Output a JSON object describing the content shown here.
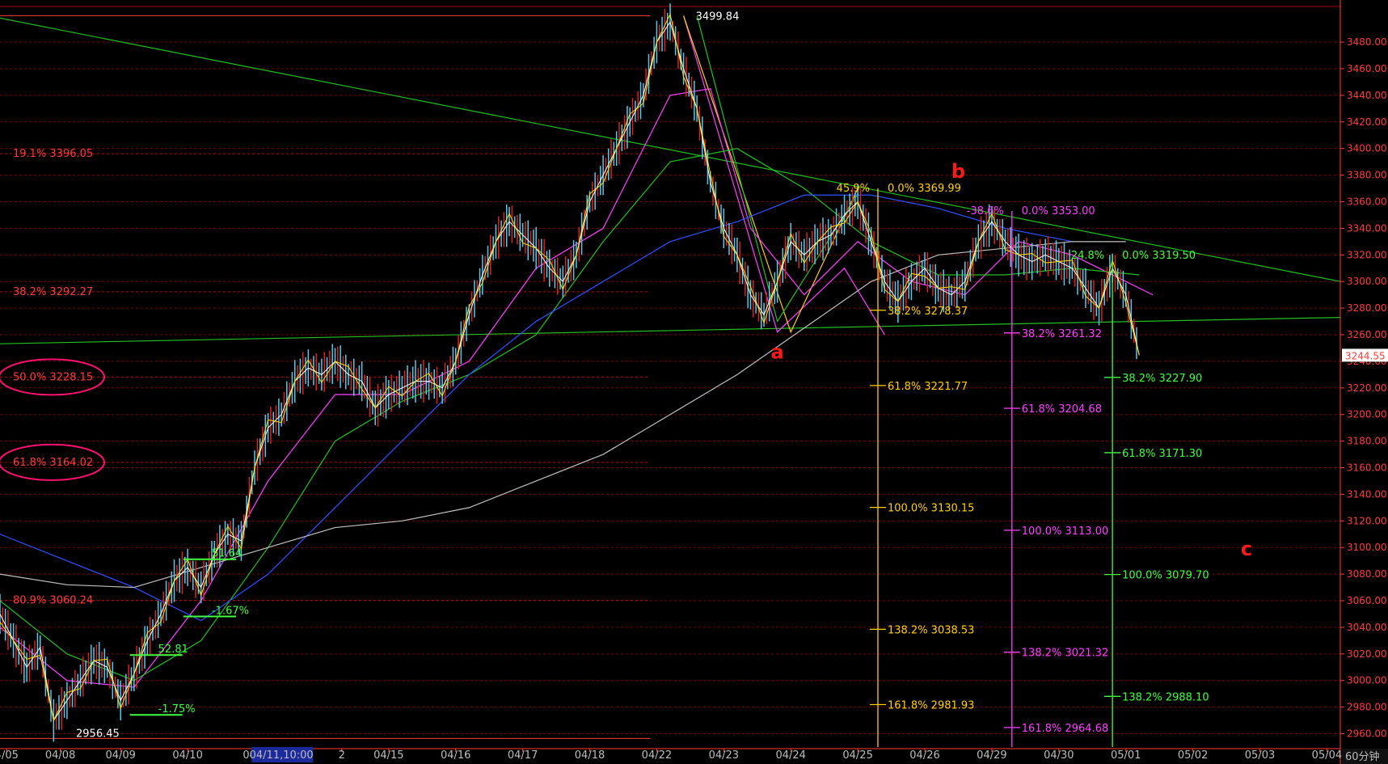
{
  "chart_data": {
    "type": "line",
    "timeframe_label": "60分钟",
    "ylim": [
      2950,
      3508
    ],
    "y_ticks": [
      2960,
      2980,
      3000,
      3020,
      3040,
      3060,
      3080,
      3100,
      3120,
      3140,
      3160,
      3180,
      3200,
      3220,
      3240,
      3260,
      3280,
      3300,
      3320,
      3340,
      3360,
      3380,
      3400,
      3420,
      3440,
      3460,
      3480
    ],
    "y_tick_labels": [
      "2960.00",
      "2980.00",
      "3000.00",
      "3020.00",
      "3040.00",
      "3060.00",
      "3080.00",
      "3100.00",
      "3120.00",
      "3140.00",
      "3160.00",
      "3180.00",
      "3200.00",
      "3220.00",
      "3240.00",
      "3260.00",
      "3280.00",
      "3300.00",
      "3320.00",
      "3340.00",
      "3360.00",
      "3380.00",
      "3400.00",
      "3420.00",
      "3440.00",
      "3460.00",
      "3480.00"
    ],
    "x_ticks": [
      {
        "label": "4/05",
        "pos": 0.5
      },
      {
        "label": "04/08",
        "pos": 4.5
      },
      {
        "label": "04/09",
        "pos": 9
      },
      {
        "label": "04/10",
        "pos": 14
      },
      {
        "label": "04/1",
        "pos": 19
      },
      {
        "label": "2",
        "pos": 25.5
      },
      {
        "label": "04/15",
        "pos": 29
      },
      {
        "label": "04/16",
        "pos": 34
      },
      {
        "label": "04/17",
        "pos": 39
      },
      {
        "label": "04/18",
        "pos": 44
      },
      {
        "label": "04/22",
        "pos": 49
      },
      {
        "label": "04/23",
        "pos": 54
      },
      {
        "label": "04/24",
        "pos": 59
      },
      {
        "label": "04/25",
        "pos": 64
      },
      {
        "label": "04/26",
        "pos": 69
      },
      {
        "label": "04/29",
        "pos": 74
      },
      {
        "label": "04/30",
        "pos": 79
      },
      {
        "label": "05/01",
        "pos": 84
      },
      {
        "label": "05/02",
        "pos": 89
      },
      {
        "label": "05/03",
        "pos": 94
      },
      {
        "label": "05/04",
        "pos": 99
      }
    ],
    "x_cursor_label": "04/11,10:00",
    "current_price": "3244.55",
    "close_series": [
      {
        "t": 0,
        "v": 3050
      },
      {
        "t": 1,
        "v": 3030
      },
      {
        "t": 2,
        "v": 3010
      },
      {
        "t": 3,
        "v": 3025
      },
      {
        "t": 4,
        "v": 2970
      },
      {
        "t": 5,
        "v": 2985
      },
      {
        "t": 6,
        "v": 3000
      },
      {
        "t": 7,
        "v": 3015
      },
      {
        "t": 8,
        "v": 3010
      },
      {
        "t": 9,
        "v": 2985
      },
      {
        "t": 10,
        "v": 3005
      },
      {
        "t": 11,
        "v": 3030
      },
      {
        "t": 12,
        "v": 3050
      },
      {
        "t": 13,
        "v": 3075
      },
      {
        "t": 14,
        "v": 3085
      },
      {
        "t": 15,
        "v": 3070
      },
      {
        "t": 16,
        "v": 3095
      },
      {
        "t": 17,
        "v": 3110
      },
      {
        "t": 18,
        "v": 3105
      },
      {
        "t": 19,
        "v": 3160
      },
      {
        "t": 20,
        "v": 3190
      },
      {
        "t": 21,
        "v": 3200
      },
      {
        "t": 22,
        "v": 3225
      },
      {
        "t": 23,
        "v": 3235
      },
      {
        "t": 24,
        "v": 3230
      },
      {
        "t": 25,
        "v": 3240
      },
      {
        "t": 26,
        "v": 3230
      },
      {
        "t": 27,
        "v": 3225
      },
      {
        "t": 28,
        "v": 3205
      },
      {
        "t": 29,
        "v": 3215
      },
      {
        "t": 30,
        "v": 3220
      },
      {
        "t": 31,
        "v": 3225
      },
      {
        "t": 32,
        "v": 3225
      },
      {
        "t": 33,
        "v": 3220
      },
      {
        "t": 34,
        "v": 3240
      },
      {
        "t": 35,
        "v": 3275
      },
      {
        "t": 36,
        "v": 3305
      },
      {
        "t": 37,
        "v": 3330
      },
      {
        "t": 38,
        "v": 3345
      },
      {
        "t": 39,
        "v": 3335
      },
      {
        "t": 40,
        "v": 3325
      },
      {
        "t": 41,
        "v": 3310
      },
      {
        "t": 42,
        "v": 3300
      },
      {
        "t": 43,
        "v": 3320
      },
      {
        "t": 44,
        "v": 3360
      },
      {
        "t": 45,
        "v": 3380
      },
      {
        "t": 46,
        "v": 3400
      },
      {
        "t": 47,
        "v": 3420
      },
      {
        "t": 48,
        "v": 3440
      },
      {
        "t": 49,
        "v": 3480
      },
      {
        "t": 50,
        "v": 3495
      },
      {
        "t": 51,
        "v": 3460
      },
      {
        "t": 52,
        "v": 3430
      },
      {
        "t": 53,
        "v": 3375
      },
      {
        "t": 54,
        "v": 3340
      },
      {
        "t": 55,
        "v": 3320
      },
      {
        "t": 56,
        "v": 3290
      },
      {
        "t": 57,
        "v": 3275
      },
      {
        "t": 58,
        "v": 3300
      },
      {
        "t": 59,
        "v": 3330
      },
      {
        "t": 60,
        "v": 3320
      },
      {
        "t": 61,
        "v": 3330
      },
      {
        "t": 62,
        "v": 3335
      },
      {
        "t": 63,
        "v": 3350
      },
      {
        "t": 64,
        "v": 3360
      },
      {
        "t": 65,
        "v": 3330
      },
      {
        "t": 66,
        "v": 3300
      },
      {
        "t": 67,
        "v": 3285
      },
      {
        "t": 68,
        "v": 3300
      },
      {
        "t": 69,
        "v": 3310
      },
      {
        "t": 70,
        "v": 3295
      },
      {
        "t": 71,
        "v": 3290
      },
      {
        "t": 72,
        "v": 3300
      },
      {
        "t": 73,
        "v": 3330
      },
      {
        "t": 74,
        "v": 3345
      },
      {
        "t": 75,
        "v": 3330
      },
      {
        "t": 76,
        "v": 3320
      },
      {
        "t": 77,
        "v": 3315
      },
      {
        "t": 78,
        "v": 3320
      },
      {
        "t": 79,
        "v": 3315
      },
      {
        "t": 80,
        "v": 3310
      },
      {
        "t": 81,
        "v": 3295
      },
      {
        "t": 82,
        "v": 3280
      },
      {
        "t": 83,
        "v": 3310
      },
      {
        "t": 84,
        "v": 3290
      },
      {
        "t": 85,
        "v": 3244.55
      }
    ],
    "ma_series": [
      {
        "name": "",
        "color": "#ff40ff",
        "values": [
          [
            0,
            3040
          ],
          [
            5,
            3000
          ],
          [
            10,
            2995
          ],
          [
            15,
            3060
          ],
          [
            20,
            3150
          ],
          [
            25,
            3215
          ],
          [
            30,
            3215
          ],
          [
            35,
            3240
          ],
          [
            40,
            3310
          ],
          [
            45,
            3340
          ],
          [
            50,
            3440
          ],
          [
            53,
            3445
          ],
          [
            56,
            3340
          ],
          [
            60,
            3290
          ],
          [
            64,
            3330
          ],
          [
            68,
            3300
          ],
          [
            72,
            3290
          ],
          [
            76,
            3330
          ],
          [
            80,
            3320
          ],
          [
            84,
            3300
          ],
          [
            86,
            3290
          ]
        ]
      },
      {
        "name": "",
        "color": "#20c020",
        "values": [
          [
            0,
            3060
          ],
          [
            5,
            3020
          ],
          [
            10,
            3000
          ],
          [
            15,
            3030
          ],
          [
            20,
            3100
          ],
          [
            25,
            3180
          ],
          [
            30,
            3210
          ],
          [
            35,
            3230
          ],
          [
            40,
            3260
          ],
          [
            45,
            3330
          ],
          [
            50,
            3390
          ],
          [
            55,
            3400
          ],
          [
            60,
            3370
          ],
          [
            65,
            3330
          ],
          [
            70,
            3305
          ],
          [
            75,
            3305
          ],
          [
            80,
            3310
          ],
          [
            85,
            3305
          ]
        ]
      },
      {
        "name": "",
        "color": "#3050ff",
        "values": [
          [
            0,
            3110
          ],
          [
            5,
            3090
          ],
          [
            10,
            3070
          ],
          [
            15,
            3045
          ],
          [
            20,
            3080
          ],
          [
            25,
            3130
          ],
          [
            30,
            3180
          ],
          [
            35,
            3230
          ],
          [
            40,
            3270
          ],
          [
            45,
            3300
          ],
          [
            50,
            3330
          ],
          [
            55,
            3345
          ],
          [
            60,
            3365
          ],
          [
            65,
            3365
          ],
          [
            70,
            3355
          ],
          [
            75,
            3340
          ],
          [
            80,
            3330
          ]
        ]
      },
      {
        "name": "",
        "color": "#c0c0c0",
        "values": [
          [
            0,
            3080
          ],
          [
            5,
            3072
          ],
          [
            10,
            3070
          ],
          [
            15,
            3085
          ],
          [
            20,
            3100
          ],
          [
            25,
            3115
          ],
          [
            30,
            3120
          ],
          [
            35,
            3130
          ],
          [
            40,
            3150
          ],
          [
            45,
            3170
          ],
          [
            50,
            3200
          ],
          [
            55,
            3230
          ],
          [
            60,
            3265
          ],
          [
            65,
            3300
          ],
          [
            70,
            3320
          ],
          [
            75,
            3325
          ],
          [
            80,
            3330
          ],
          [
            84,
            3330
          ]
        ]
      }
    ],
    "trendlines": [
      {
        "color": "#20c020",
        "points": [
          [
            -1,
            3500
          ],
          [
            100,
            3300
          ]
        ]
      },
      {
        "color": "#20c020",
        "points": [
          [
            -1,
            3253
          ],
          [
            100,
            3273
          ]
        ]
      },
      {
        "color": "#ff40ff",
        "points": [
          [
            51,
            3499.84
          ],
          [
            58,
            3262
          ],
          [
            63,
            3310
          ],
          [
            66,
            3260
          ]
        ]
      },
      {
        "color": "#ffd000",
        "points": [
          [
            51,
            3499.84
          ],
          [
            59,
            3262
          ],
          [
            64,
            3369.99
          ]
        ]
      },
      {
        "color": "#20c020",
        "points": [
          [
            52,
            3499.84
          ],
          [
            58,
            3270
          ],
          [
            64,
            3366
          ]
        ]
      }
    ],
    "high_label": "3499.84",
    "low_label": "2956.45",
    "wave_labels": [
      {
        "text": "a",
        "t": 58,
        "v": 3242
      },
      {
        "text": "b",
        "t": 71.5,
        "v": 3378
      },
      {
        "text": "c",
        "t": 93,
        "v": 3094
      }
    ],
    "left_fib": [
      {
        "text": "19.1% 3396.05",
        "v": 3396.05
      },
      {
        "text": "38.2% 3292.27",
        "v": 3292.27
      },
      {
        "text": "50.0% 3228.15",
        "v": 3228.15,
        "circled": true
      },
      {
        "text": "61.8% 3164.02",
        "v": 3164.02,
        "circled": true
      },
      {
        "text": "80.9% 3060.24",
        "v": 3060.24
      }
    ],
    "fib_yellow": {
      "t": 65.5,
      "color": "#ffd000",
      "top_label": "0.0% 3369.99",
      "side_label": "45.9%",
      "levels": [
        {
          "text": "38.2% 3278.37",
          "v": 3278.37
        },
        {
          "text": "61.8% 3221.77",
          "v": 3221.77
        },
        {
          "text": "100.0% 3130.15",
          "v": 3130.15
        },
        {
          "text": "138.2% 3038.53",
          "v": 3038.53
        },
        {
          "text": "161.8% 2981.93",
          "v": 2981.93
        }
      ]
    },
    "fib_magenta": {
      "t": 75.5,
      "color": "#ff40ff",
      "top_label": "0.0% 3353.00",
      "side_label": "-38.6%",
      "levels": [
        {
          "text": "38.2% 3261.32",
          "v": 3261.32
        },
        {
          "text": "61.8% 3204.68",
          "v": 3204.68
        },
        {
          "text": "100.0% 3113.00",
          "v": 3113.0
        },
        {
          "text": "138.2% 3021.32",
          "v": 3021.32
        },
        {
          "text": "161.8% 2964.68",
          "v": 2964.68
        }
      ]
    },
    "fib_green": {
      "t": 83,
      "color": "#40ff40",
      "top_label": "0.0% 3319.50",
      "side_label": "24.8%",
      "levels": [
        {
          "text": "38.2% 3227.90",
          "v": 3227.9
        },
        {
          "text": "61.8% 3171.30",
          "v": 3171.3
        },
        {
          "text": "100.0% 3079.70",
          "v": 3079.7
        },
        {
          "text": "138.2% 2988.10",
          "v": 2988.1
        }
      ]
    },
    "small_markers": [
      {
        "text": "51.64",
        "t": 15.5,
        "v": 3093
      },
      {
        "text": "-1.67%",
        "t": 15.5,
        "v": 3050
      },
      {
        "text": "52.81",
        "t": 11.5,
        "v": 3021
      },
      {
        "text": "-1.75%",
        "t": 11.5,
        "v": 2976
      }
    ]
  }
}
